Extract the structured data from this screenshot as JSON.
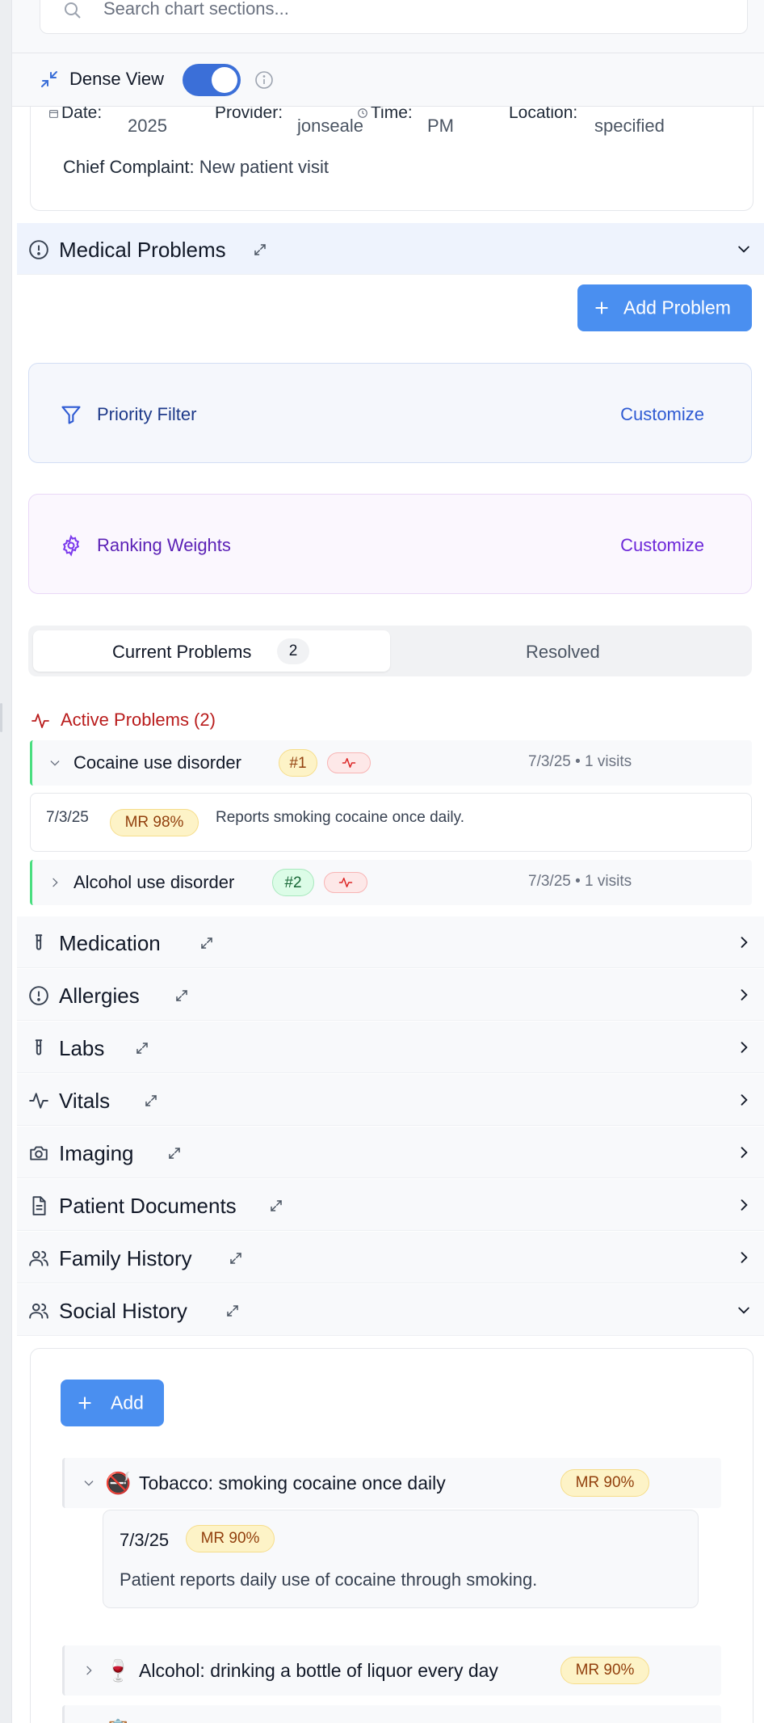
{
  "search": {
    "placeholder": "Search chart sections..."
  },
  "dense_view": {
    "label": "Dense View",
    "enabled": true
  },
  "encounter": {
    "date_label": "Date:",
    "date_value": "2025",
    "provider_label": "Provider:",
    "provider_value": "jonseale",
    "time_label": "Time:",
    "time_value": "PM",
    "location_label": "Location:",
    "location_value": "specified",
    "complaint_label": "Chief Complaint:",
    "complaint_value": "New patient visit"
  },
  "medical_problems": {
    "title": "Medical Problems",
    "add_button": "Add Problem",
    "priority_filter": {
      "label": "Priority Filter",
      "action": "Customize"
    },
    "ranking_weights": {
      "label": "Ranking Weights",
      "action": "Customize"
    },
    "tabs": {
      "current_label": "Current Problems",
      "current_count": "2",
      "resolved_label": "Resolved"
    },
    "active_heading": "Active Problems (2)",
    "problems": [
      {
        "name": "Cocaine use disorder",
        "rank": "#1",
        "meta": "7/3/25 • 1 visits",
        "expanded": true,
        "detail": {
          "date": "7/3/25",
          "badge": "MR 98%",
          "text": "Reports smoking cocaine once daily."
        }
      },
      {
        "name": "Alcohol use disorder",
        "rank": "#2",
        "meta": "7/3/25 • 1 visits",
        "expanded": false
      }
    ]
  },
  "sections": [
    {
      "title": "Medication",
      "icon": "test-tube-icon"
    },
    {
      "title": "Allergies",
      "icon": "alert-circle-icon"
    },
    {
      "title": "Labs",
      "icon": "test-tube-icon"
    },
    {
      "title": "Vitals",
      "icon": "activity-icon"
    },
    {
      "title": "Imaging",
      "icon": "camera-icon"
    },
    {
      "title": "Patient Documents",
      "icon": "document-icon"
    },
    {
      "title": "Family History",
      "icon": "users-icon"
    }
  ],
  "social_history": {
    "title": "Social History",
    "add_button": "Add",
    "items": [
      {
        "emoji": "🚭",
        "text": "Tobacco: smoking cocaine once daily",
        "badge": "MR 90%",
        "detail": {
          "date": "7/3/25",
          "badge": "MR 90%",
          "text": "Patient reports daily use of cocaine through smoking."
        }
      },
      {
        "emoji": "🍷",
        "text": "Alcohol: drinking a bottle of liquor every day",
        "badge": "MR 90%"
      },
      {
        "emoji": "📋",
        "text": "",
        "badge": ""
      }
    ]
  },
  "colors": {
    "primary_button": "#4a8ff0",
    "toggle_on": "#3b6fd8",
    "active_problems": "#b91c1c",
    "priority_text": "#1e3a8a",
    "ranking_text": "#5b21b6"
  }
}
